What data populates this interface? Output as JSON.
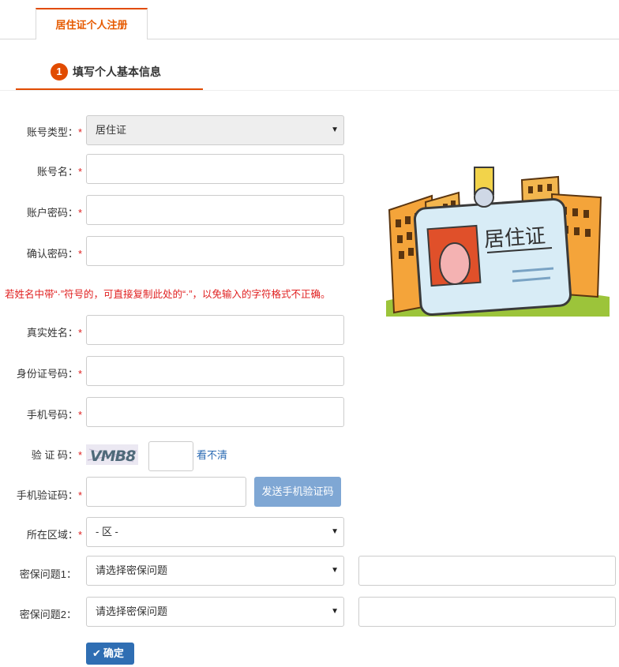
{
  "tab": {
    "label": "居住证个人注册"
  },
  "step": {
    "number": "1",
    "label": "填写个人基本信息"
  },
  "form": {
    "required_mark": "*",
    "account_type": {
      "label": "账号类型：",
      "value": "居住证"
    },
    "account_name": {
      "label": "账号名：",
      "value": ""
    },
    "password": {
      "label": "账户密码：",
      "value": ""
    },
    "confirm_password": {
      "label": "确认密码：",
      "value": ""
    },
    "warning": "若姓名中带“·”符号的，可直接复制此处的“·”，以免输入的字符格式不正确。",
    "real_name": {
      "label": "真实姓名：",
      "value": ""
    },
    "id_number": {
      "label": "身份证号码：",
      "value": ""
    },
    "phone": {
      "label": "手机号码：",
      "value": ""
    },
    "captcha": {
      "label": "验 证 码：",
      "image_text": "VMB8",
      "refresh_label": "看不清"
    },
    "sms_code": {
      "label": "手机验证码：",
      "button_label": "发送手机验证码"
    },
    "region": {
      "label": "所在区域：",
      "value": "- 区 -"
    },
    "question1": {
      "label": "密保问题1：",
      "value": "请选择密保问题"
    },
    "question2": {
      "label": "密保问题2：",
      "value": "请选择密保问题"
    },
    "submit_label": "确定"
  },
  "illustration": {
    "card_text": "居住证"
  },
  "colors": {
    "accent": "#e14b00",
    "required": "#e02020",
    "primary": "#2f6eb3",
    "sms_button": "#7fa7d4"
  }
}
